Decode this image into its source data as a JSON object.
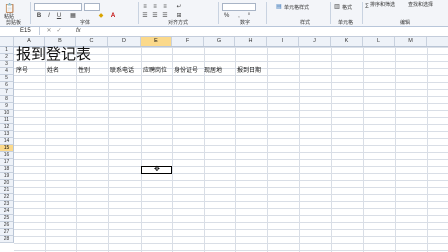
{
  "ribbon": {
    "clipboard_label": "剪贴板",
    "paste_label": "粘贴",
    "font_label": "字体",
    "align_label": "对齐方式",
    "number_label": "数字",
    "number_format": "%",
    "style_label": "样式",
    "conditional_label": "单元格样式",
    "format_label": "格式",
    "cells_label": "单元格",
    "edit_label": "编辑",
    "sort_label": "排序和筛选",
    "find_label": "查找和选择"
  },
  "formula_bar": {
    "name_box": "E15",
    "fx": "fx",
    "content": ""
  },
  "columns": [
    "A",
    "B",
    "C",
    "D",
    "E",
    "F",
    "G",
    "H",
    "I",
    "J",
    "K",
    "L",
    "M"
  ],
  "selected_column": "E",
  "rows": [
    "1",
    "2",
    "3",
    "4",
    "5",
    "6",
    "7",
    "8",
    "9",
    "10",
    "11",
    "12",
    "13",
    "14",
    "15",
    "16",
    "17",
    "18",
    "19",
    "20",
    "21",
    "22",
    "23",
    "24",
    "25",
    "26",
    "27",
    "28"
  ],
  "selected_row": "15",
  "sheet": {
    "title": "报到登记表",
    "headers": [
      "序号",
      "姓名",
      "性别",
      "联系电话",
      "应聘岗位",
      "身份证号",
      "现居地",
      "报到日期"
    ]
  }
}
